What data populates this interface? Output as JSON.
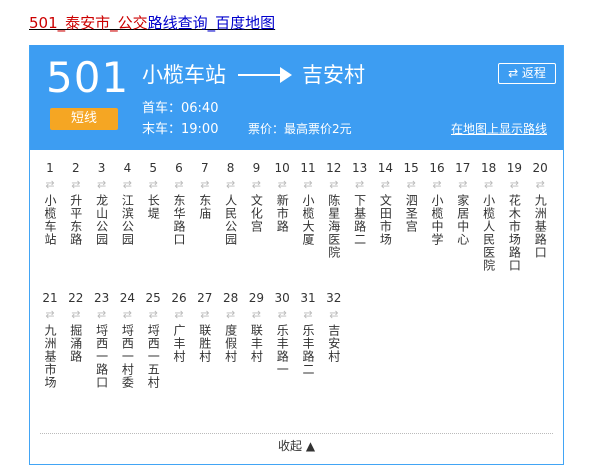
{
  "page_link": {
    "part1": "501_泰安市_公交",
    "part2": "路线查询_百度地图"
  },
  "header": {
    "line_number": "501",
    "line_type": "短线",
    "from": "小榄车站",
    "to": "吉安村",
    "return_label": "⇄ 返程",
    "first_bus": "首车：06:40",
    "last_bus": "末车：19:00",
    "fare": "票价：最高票价2元",
    "map_link": "在地图上显示路线"
  },
  "stops": [
    {
      "num": "1",
      "name": "小榄车站"
    },
    {
      "num": "2",
      "name": "升平东路"
    },
    {
      "num": "3",
      "name": "龙山公园"
    },
    {
      "num": "4",
      "name": "江滨公园"
    },
    {
      "num": "5",
      "name": "长堤"
    },
    {
      "num": "6",
      "name": "东华路口"
    },
    {
      "num": "7",
      "name": "东庙"
    },
    {
      "num": "8",
      "name": "人民公园"
    },
    {
      "num": "9",
      "name": "文化宫"
    },
    {
      "num": "10",
      "name": "新市路"
    },
    {
      "num": "11",
      "name": "小榄大厦"
    },
    {
      "num": "12",
      "name": "陈星海医院"
    },
    {
      "num": "13",
      "name": "下基路二"
    },
    {
      "num": "14",
      "name": "文田市场"
    },
    {
      "num": "15",
      "name": "泗圣宫"
    },
    {
      "num": "16",
      "name": "小榄中学"
    },
    {
      "num": "17",
      "name": "家居中心"
    },
    {
      "num": "18",
      "name": "小榄人民医院"
    },
    {
      "num": "19",
      "name": "花木市场路口"
    },
    {
      "num": "20",
      "name": "九洲基路口"
    },
    {
      "num": "21",
      "name": "九洲基市场"
    },
    {
      "num": "22",
      "name": "掘涌路"
    },
    {
      "num": "23",
      "name": "埒西一路口"
    },
    {
      "num": "24",
      "name": "埒西一村委"
    },
    {
      "num": "25",
      "name": "埒西一五村"
    },
    {
      "num": "26",
      "name": "广丰村"
    },
    {
      "num": "27",
      "name": "联胜村"
    },
    {
      "num": "28",
      "name": "度假村"
    },
    {
      "num": "29",
      "name": "联丰村"
    },
    {
      "num": "30",
      "name": "乐丰路一"
    },
    {
      "num": "31",
      "name": "乐丰路二"
    },
    {
      "num": "32",
      "name": "吉安村"
    }
  ],
  "swap_symbol": "⇄",
  "collapse_label": "收起 ▲"
}
